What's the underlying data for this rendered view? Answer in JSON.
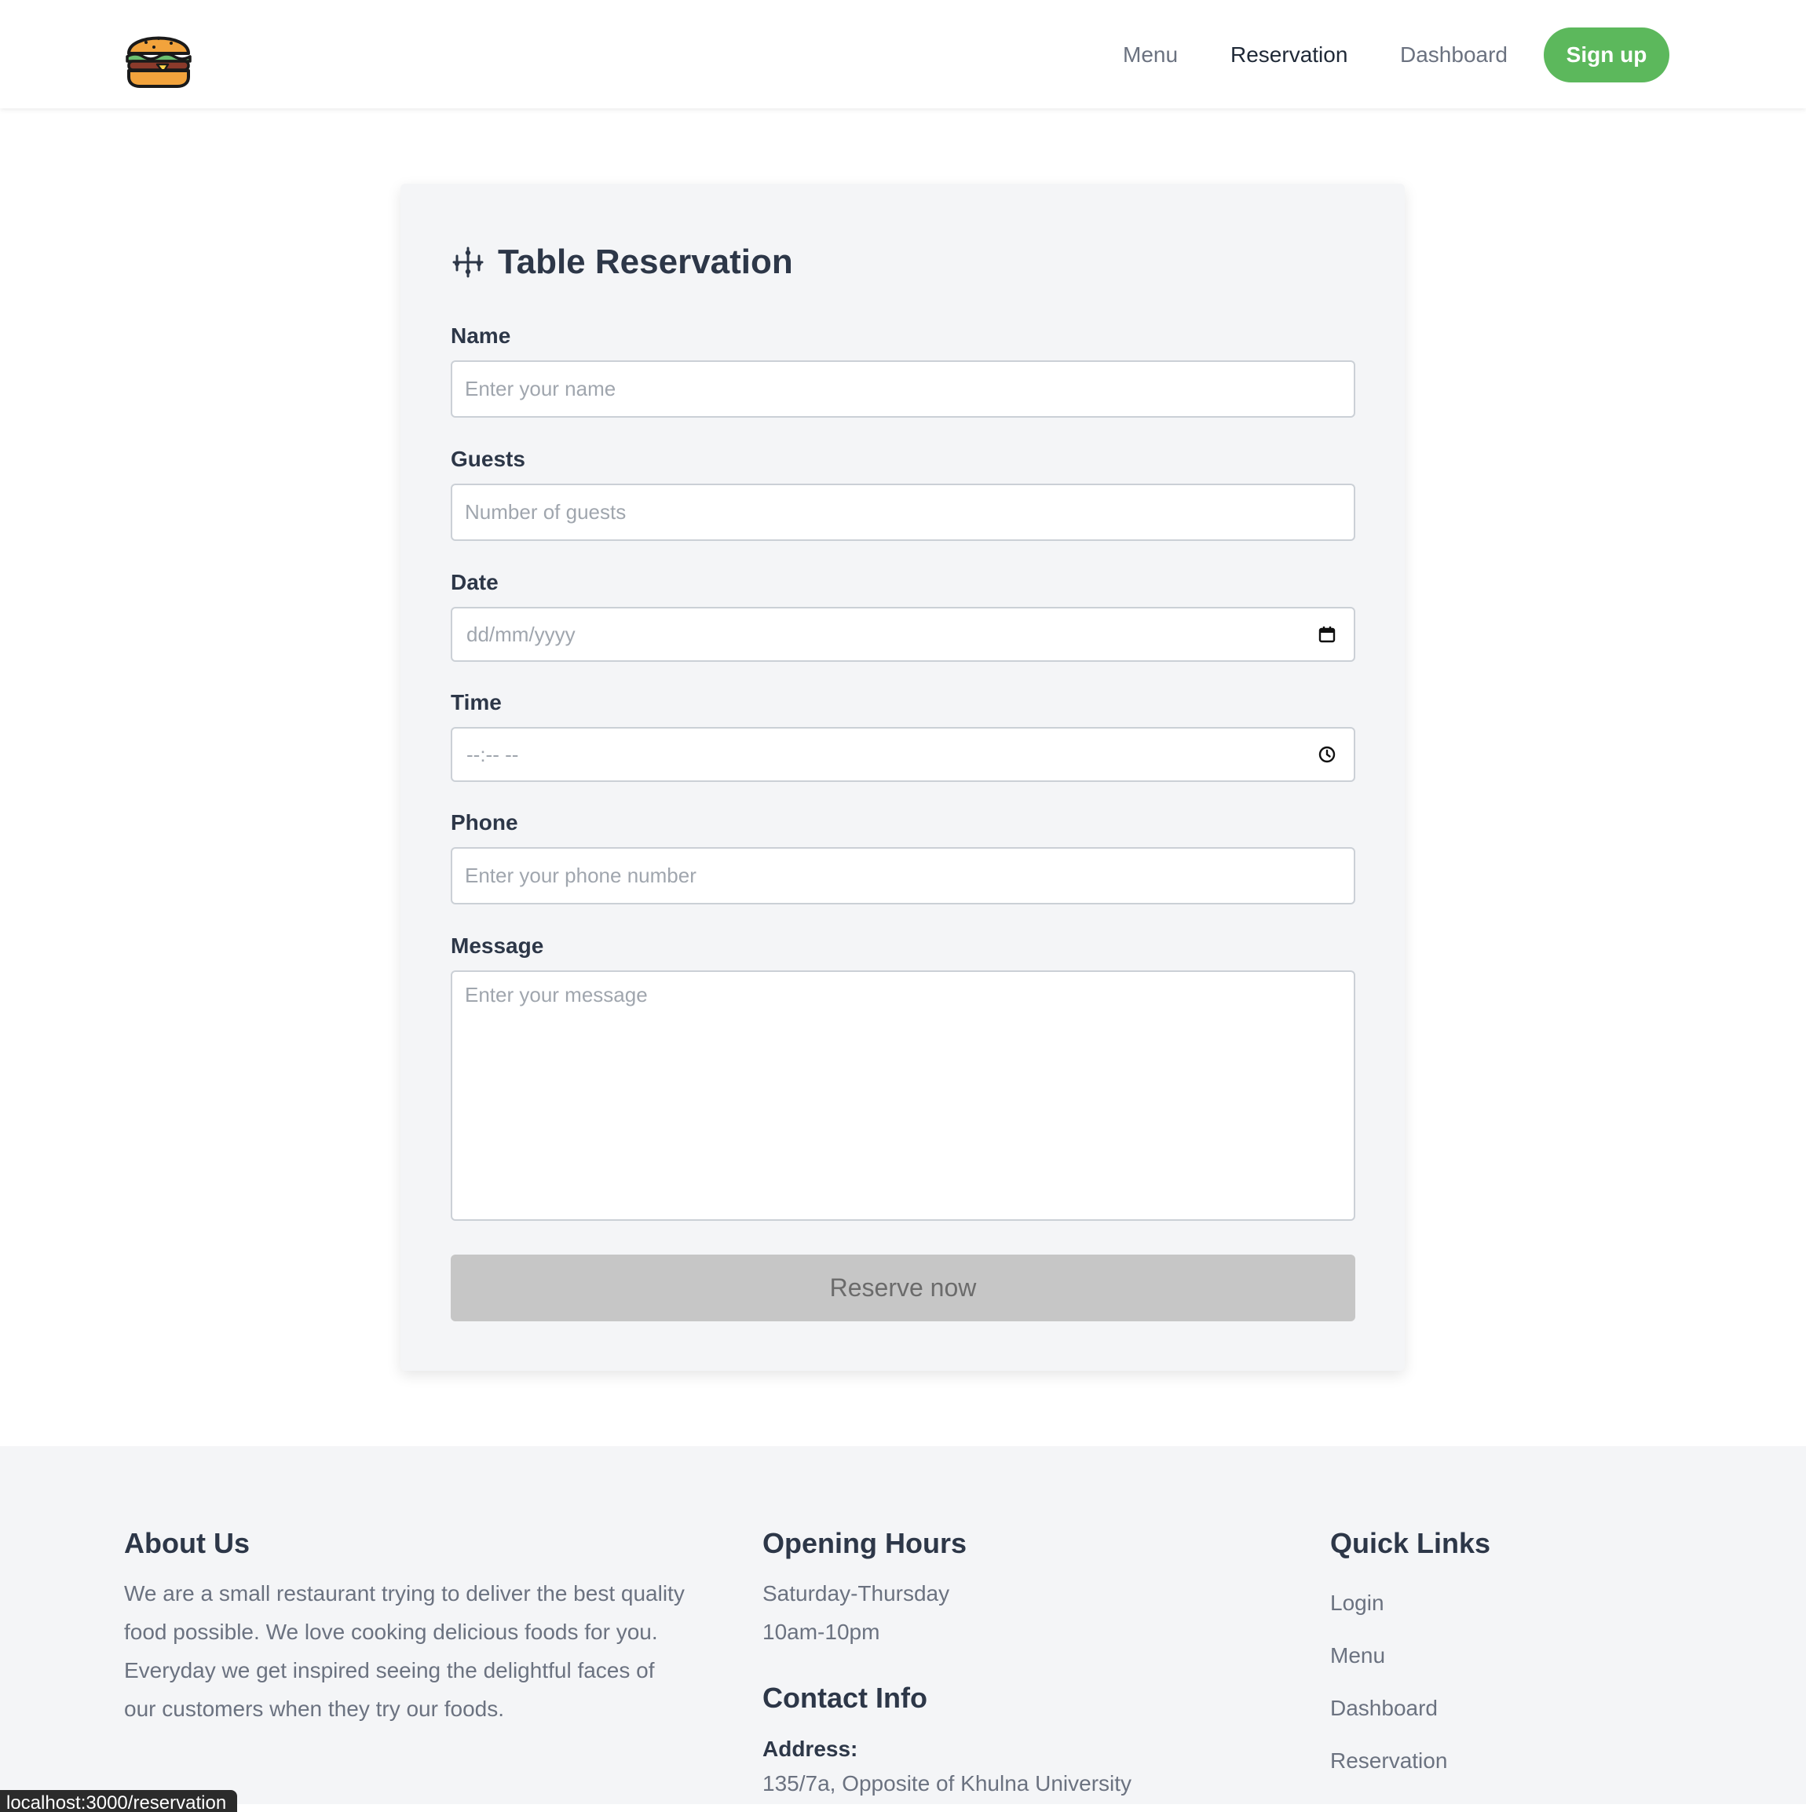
{
  "nav": {
    "logo_alt": "burger-logo",
    "links": [
      "Menu",
      "Reservation",
      "Dashboard"
    ],
    "active": "Reservation",
    "signup_label": "Sign up"
  },
  "form": {
    "title": "Table Reservation",
    "fields": {
      "name": {
        "label": "Name",
        "placeholder": "Enter your name"
      },
      "guests": {
        "label": "Guests",
        "placeholder": "Number of guests"
      },
      "date": {
        "label": "Date",
        "placeholder": "dd/mm/yyyy"
      },
      "time": {
        "label": "Time",
        "placeholder": "--:-- --"
      },
      "phone": {
        "label": "Phone",
        "placeholder": "Enter your phone number"
      },
      "message": {
        "label": "Message",
        "placeholder": "Enter your message"
      }
    },
    "submit_label": "Reserve now"
  },
  "footer": {
    "about": {
      "heading": "About Us",
      "text": "We are a small restaurant trying to deliver the best quality food possible. We love cooking delicious foods for you. Everyday we get inspired seeing the delightful faces of our customers when they try our foods."
    },
    "hours": {
      "heading": "Opening Hours",
      "days": "Saturday-Thursday",
      "time": "10am-10pm"
    },
    "contact": {
      "heading": "Contact Info",
      "address_label": "Address:",
      "address": "135/7a, Opposite of Khulna University"
    },
    "quick_links": {
      "heading": "Quick Links",
      "items": [
        "Login",
        "Menu",
        "Dashboard",
        "Reservation"
      ]
    }
  },
  "status_bar": {
    "url": "localhost:3000/reservation"
  },
  "colors": {
    "accent": "#5cb85c",
    "card_bg": "#f4f5f7",
    "button_disabled": "#c6c6c6"
  }
}
